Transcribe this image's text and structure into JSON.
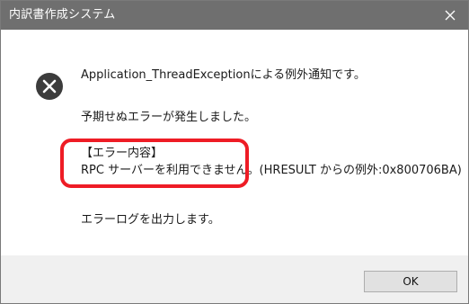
{
  "window": {
    "title": "内訳書作成システム",
    "close_glyph": "×"
  },
  "icons": {
    "error": "error-x-circle-icon",
    "close": "close-icon"
  },
  "message": {
    "headline": "Application_ThreadExceptionによる例外通知です。",
    "unexpected": "予期せぬエラーが発生しました。",
    "detail_header": "【エラー内容】",
    "detail_body": "RPC サーバーを利用できません。(HRESULT からの例外:0x800706BA)",
    "log_output": "エラーログを出力します。"
  },
  "buttons": {
    "ok_label": "OK"
  },
  "colors": {
    "titlebar": "#6f6f6f",
    "icon_circle": "#3c3c3c",
    "highlight": "#ee1c25",
    "footer": "#f0f0f0"
  }
}
